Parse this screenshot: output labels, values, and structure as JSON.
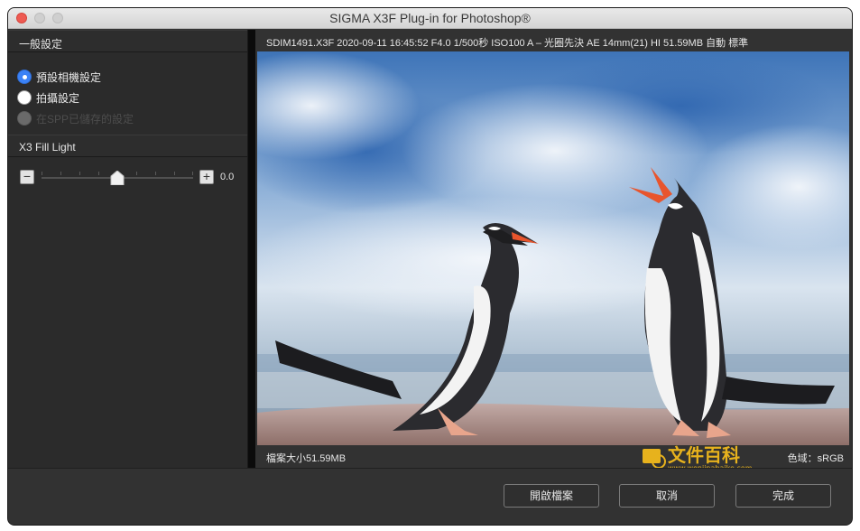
{
  "window": {
    "title": "SIGMA X3F Plug-in for Photoshop®"
  },
  "left_panel": {
    "general_header": "一般設定",
    "radios": [
      {
        "label": "預設相機設定",
        "checked": true,
        "disabled": false
      },
      {
        "label": "拍攝設定",
        "checked": false,
        "disabled": false
      },
      {
        "label": "在SPP已儲存的設定",
        "checked": false,
        "disabled": true
      }
    ],
    "fill_light_header": "X3 Fill Light",
    "fill_light": {
      "value_text": "0.0",
      "minus": "−",
      "plus": "+",
      "level": 0.5
    }
  },
  "info_bar": {
    "text": "SDIM1491.X3F 2020-09-11 16:45:52 F4.0 1/500秒 ISO100 A – 光圈先決 AE 14mm(21) HI 51.59MB 自動 標準"
  },
  "status_bar": {
    "file_size": "檔案大小51.59MB",
    "color_space": "色域：sRGB"
  },
  "watermark": {
    "text_cn": "文件百科",
    "url": "www.wenjinabaike.com"
  },
  "buttons": {
    "open": "開啟檔案",
    "cancel": "取消",
    "done": "完成"
  },
  "colors": {
    "accent": "#3b82f6",
    "close_button": "#ee5a52",
    "panel_bg": "#2b2b2b"
  }
}
